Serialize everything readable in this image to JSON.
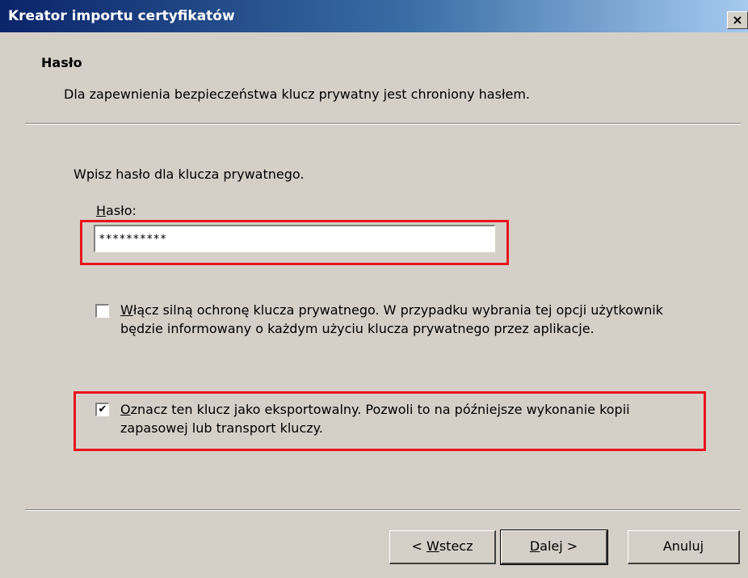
{
  "window": {
    "title": "Kreator importu certyfikatów",
    "close_glyph": "×"
  },
  "header": {
    "title": "Hasło",
    "subtitle": "Dla zapewnienia bezpieczeństwa klucz prywatny jest chroniony hasłem."
  },
  "main": {
    "prompt": "Wpisz hasło dla klucza prywatnego.",
    "password_label_mnemonic": "H",
    "password_label_rest": "asło:",
    "password_value": "**********",
    "strong_protection": {
      "checked": false,
      "mnemonic": "W",
      "label_rest": "łącz silną ochronę klucza prywatnego. W przypadku wybrania tej opcji użytkownik będzie informowany o każdym użyciu klucza prywatnego przez aplikacje."
    },
    "exportable": {
      "checked": true,
      "check_glyph": "✔",
      "mnemonic": "O",
      "label_rest": "znacz ten klucz jako eksportowalny. Pozwoli to na późniejsze wykonanie kopii zapasowej lub transport kluczy."
    }
  },
  "buttons": {
    "back_prefix": "< ",
    "back_mnemonic": "W",
    "back_rest": "stecz",
    "next_mnemonic": "D",
    "next_rest": "alej >",
    "cancel": "Anuluj"
  },
  "colors": {
    "highlight": "#e8141e",
    "title_bar_start": "#0a246a",
    "dialog_bg": "#d4d0c8"
  }
}
